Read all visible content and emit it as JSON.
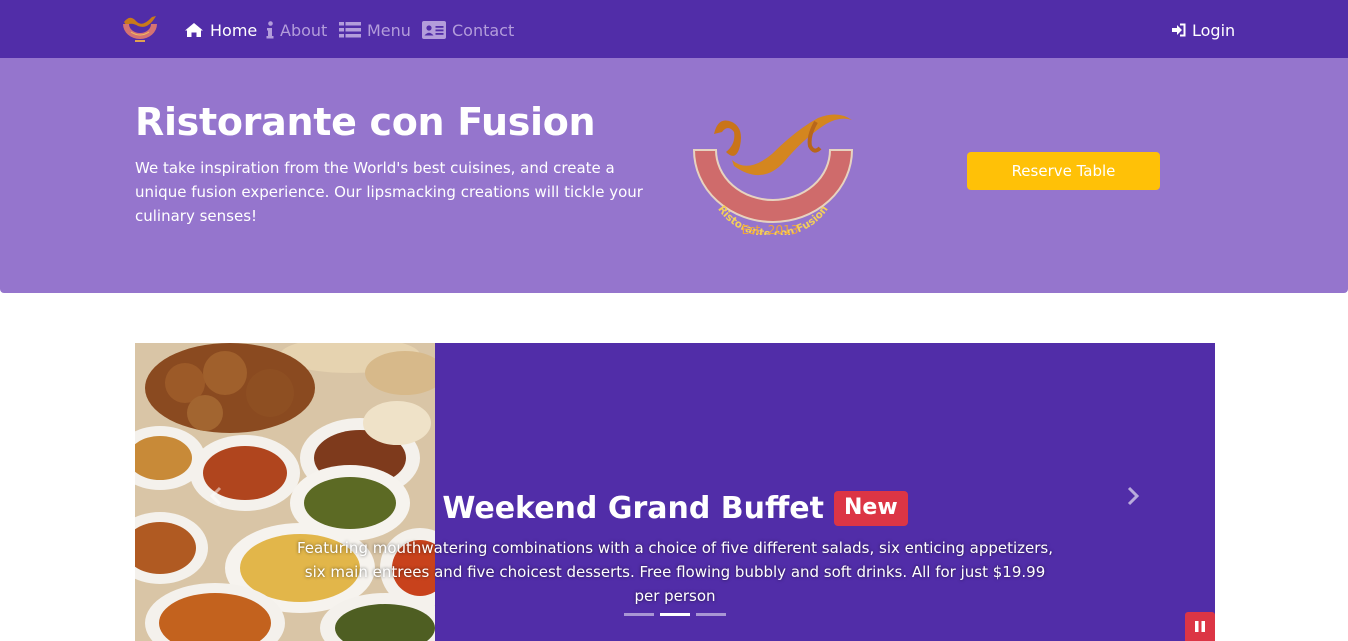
{
  "navbar": {
    "brand_icon": "restaurant-logo-small",
    "items": [
      {
        "label": "Home",
        "icon": "home-icon",
        "active": true
      },
      {
        "label": "About",
        "icon": "info-icon",
        "active": false
      },
      {
        "label": "Menu",
        "icon": "list-icon",
        "active": false
      },
      {
        "label": "Contact",
        "icon": "address-card-icon",
        "active": false
      }
    ],
    "login": {
      "label": "Login",
      "icon": "sign-in-icon"
    }
  },
  "jumbotron": {
    "title": "Ristorante con Fusion",
    "text": "We take inspiration from the World's best cuisines, and create a unique fusion experience. Our lipsmacking creations will tickle your culinary senses!",
    "logo": {
      "arc_text": "Ristorante con Fusion",
      "est_text": "Est. 2013"
    },
    "reserve_button": "Reserve Table"
  },
  "carousel": {
    "slide": {
      "image": "buffet-dishes-photo",
      "title": "Weekend Grand Buffet",
      "badge": "New",
      "text": "Featuring mouthwatering combinations with a choice of five different salads, six enticing appetizers, six main entrees and five choicest desserts. Free flowing bubbly and soft drinks. All for just $19.99 per person"
    },
    "indicators": [
      false,
      true,
      false
    ],
    "controls": {
      "prev_icon": "chevron-left-icon",
      "next_icon": "chevron-right-icon",
      "pause_icon": "pause-icon"
    }
  },
  "colors": {
    "primary": "#512da8",
    "jumbotron": "#9575cd",
    "nav_inactive": "#b39ddb",
    "warning": "#ffc107",
    "danger": "#dc3545"
  }
}
